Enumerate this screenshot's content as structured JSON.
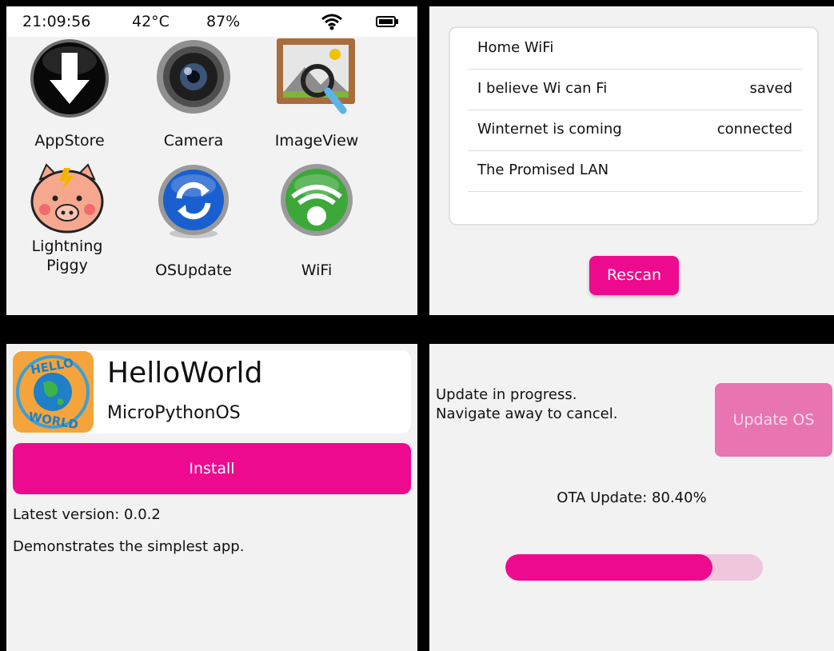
{
  "launcher": {
    "status": {
      "time": "21:09:56",
      "temp": "42°C",
      "battery_pct": "87%"
    },
    "apps": [
      {
        "label": "AppStore",
        "icon": "appstore-download-icon"
      },
      {
        "label": "Camera",
        "icon": "camera-lens-icon"
      },
      {
        "label": "ImageView",
        "icon": "image-magnifier-icon"
      },
      {
        "label": "Lightning Piggy",
        "icon": "piggy-icon"
      },
      {
        "label": "OSUpdate",
        "icon": "refresh-icon"
      },
      {
        "label": "WiFi",
        "icon": "wifi-icon"
      }
    ]
  },
  "wifi": {
    "networks": [
      {
        "name": "Home WiFi",
        "status": ""
      },
      {
        "name": "I believe Wi can Fi",
        "status": "saved"
      },
      {
        "name": "Winternet is coming",
        "status": "connected"
      },
      {
        "name": "The Promised LAN",
        "status": ""
      }
    ],
    "rescan_label": "Rescan"
  },
  "appstore_detail": {
    "app_name": "HelloWorld",
    "publisher": "MicroPythonOS",
    "logo_text": "HELLO WORLD",
    "install_label": "Install",
    "version_text": "Latest version: 0.0.2",
    "description": "Demonstrates the simplest app."
  },
  "osupdate": {
    "message_line1": "Update in progress.",
    "message_line2": "Navigate away to cancel.",
    "button_label": "Update OS",
    "progress_text": "OTA Update: 80.40%",
    "progress_value": 80.4
  },
  "colors": {
    "accent": "#ee0a8e",
    "accent_disabled": "#e874b2",
    "track": "#efc6dc",
    "panel_bg": "#f2f2f2"
  }
}
